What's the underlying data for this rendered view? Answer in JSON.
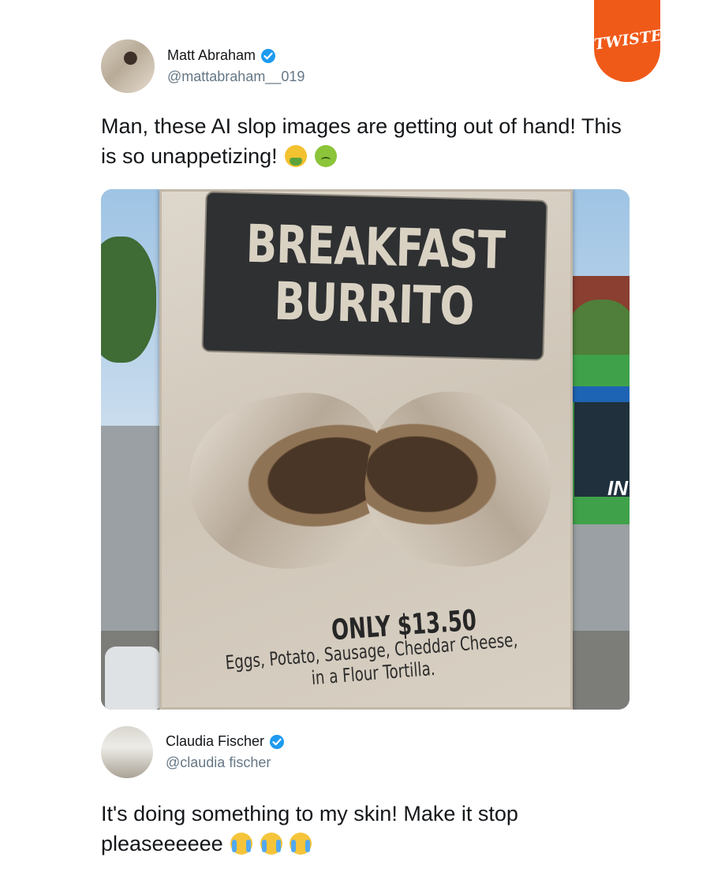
{
  "brand": {
    "logo_text": "TWISTED",
    "color": "#f05a19"
  },
  "tweet1": {
    "author_name": "Matt Abraham",
    "handle": "@mattabraham__019",
    "verified": true,
    "text": "Man, these AI slop images are getting out of hand! This is so unappetizing!",
    "emojis": [
      "vomiting-face-emoji",
      "nauseated-face-emoji"
    ]
  },
  "image": {
    "sign_title_line1": "BREAKFAST",
    "sign_title_line2": "BURRITO",
    "price": "ONLY $13.50",
    "ingredients_line1": "Eggs, Potato, Sausage, Cheddar Cheese,",
    "ingredients_line2": "in a Flour Tortilla.",
    "bus_text": "IN"
  },
  "tweet2": {
    "author_name": "Claudia Fischer",
    "handle": "@claudia fischer",
    "verified": true,
    "text": "It's doing something to my skin! Make it stop pleaseeeeee",
    "emojis": [
      "crying-face-emoji",
      "crying-face-emoji",
      "crying-face-emoji"
    ]
  },
  "colors": {
    "verified_badge": "#1d9bf0",
    "handle_text": "#657786"
  }
}
